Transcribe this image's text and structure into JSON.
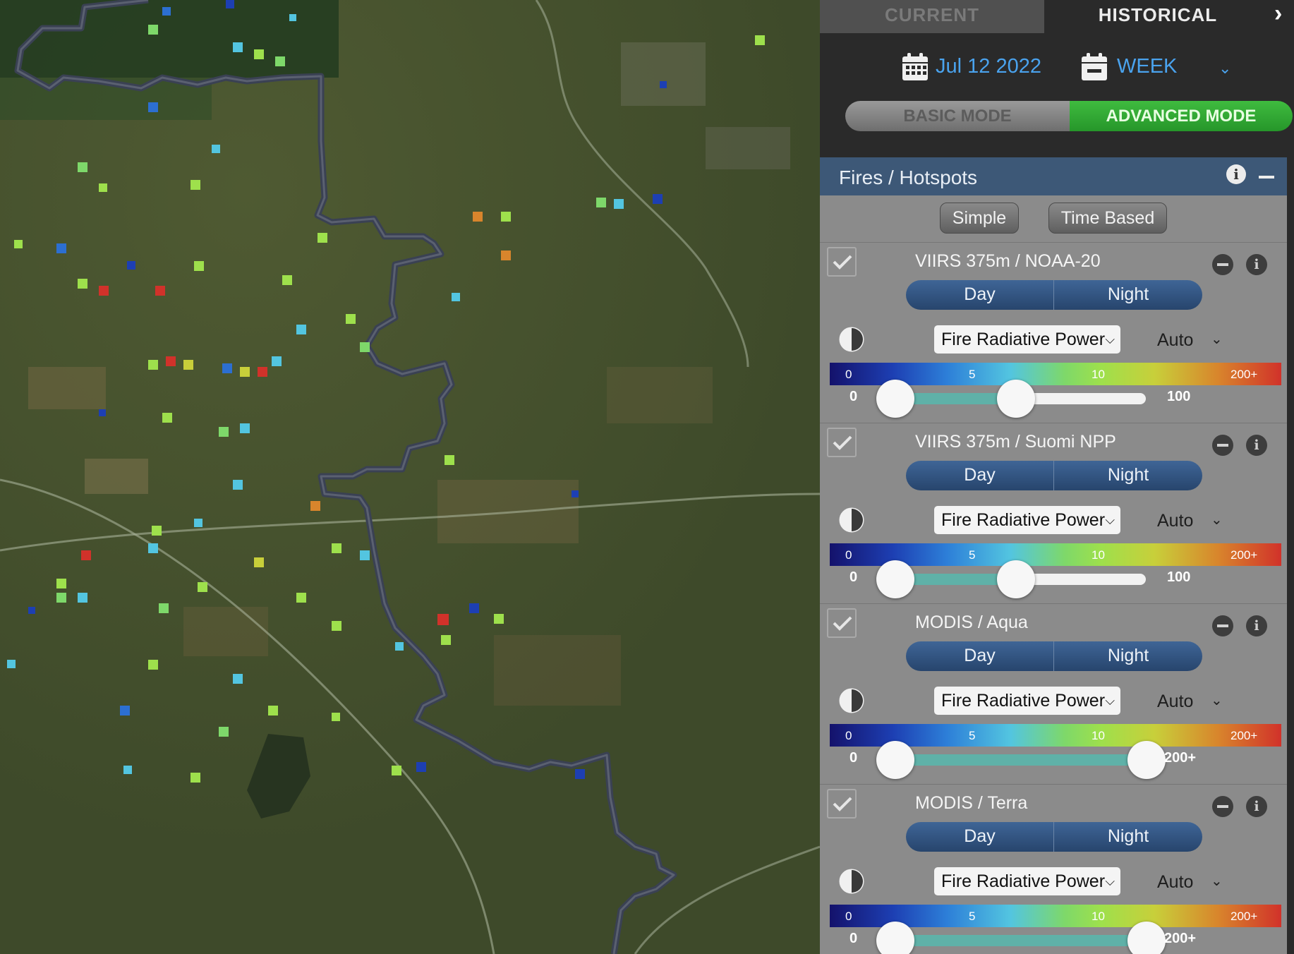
{
  "tabs": {
    "current": "CURRENT",
    "historical": "HISTORICAL",
    "active": "historical"
  },
  "date": {
    "value": "Jul 12 2022",
    "interval": "WEEK"
  },
  "mode": {
    "basic": "BASIC MODE",
    "advanced": "ADVANCED MODE",
    "active": "advanced"
  },
  "layer": {
    "title": "Fires / Hotspots",
    "display_options": [
      "Simple",
      "Time Based"
    ],
    "sources": [
      {
        "name": "VIIRS 375m / NOAA-20",
        "checked": true,
        "day": "Day",
        "night": "Night",
        "attribute": "Fire Radiative Power",
        "scale": "Auto",
        "legend": [
          "0",
          "5",
          "10",
          "200+"
        ],
        "range_min_label": "0",
        "range_max_label": "100",
        "range_min": 0,
        "range_max": 100
      },
      {
        "name": "VIIRS 375m / Suomi NPP",
        "checked": true,
        "day": "Day",
        "night": "Night",
        "attribute": "Fire Radiative Power",
        "scale": "Auto",
        "legend": [
          "0",
          "5",
          "10",
          "200+"
        ],
        "range_min_label": "0",
        "range_max_label": "100",
        "range_min": 0,
        "range_max": 100
      },
      {
        "name": "MODIS / Aqua",
        "checked": true,
        "day": "Day",
        "night": "Night",
        "attribute": "Fire Radiative Power",
        "scale": "Auto",
        "legend": [
          "0",
          "5",
          "10",
          "200+"
        ],
        "range_min_label": "0",
        "range_max_label": "200+",
        "range_min": 0,
        "range_max": 200
      },
      {
        "name": "MODIS / Terra",
        "checked": true,
        "day": "Day",
        "night": "Night",
        "attribute": "Fire Radiative Power",
        "scale": "Auto",
        "legend": [
          "0",
          "5",
          "10",
          "200+"
        ],
        "range_min_label": "0",
        "range_max_label": "200+",
        "range_min": 0,
        "range_max": 200
      }
    ]
  },
  "colors": {
    "accent": "#4aa3ee",
    "advanced_active": "#2fa832",
    "header": "#3d5877",
    "border": "#3a4153"
  }
}
